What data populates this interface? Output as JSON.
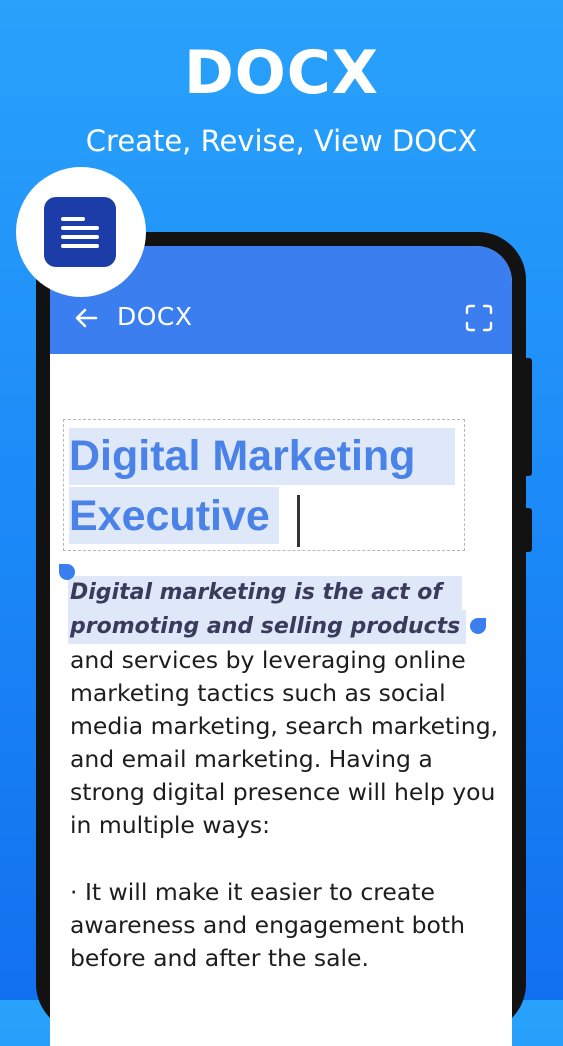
{
  "hero": {
    "title": "DOCX",
    "subtitle": "Create, Revise, View DOCX"
  },
  "appbar": {
    "title": "DOCX",
    "back_icon": "back-arrow-icon",
    "fullscreen_icon": "fullscreen-icon"
  },
  "badge": {
    "icon": "document-icon"
  },
  "document": {
    "heading": "Digital Marketing Executive",
    "intro": "Digital marketing is the act of promoting and selling products",
    "body": "and services by leveraging online marketing tactics such as social media marketing, search marketing, and email marketing. Having a strong digital presence will help you in multiple ways:",
    "bullet": "· It will make it easier to create awareness and engagement both before and after the sale."
  },
  "colors": {
    "background": "#1b88f7",
    "appbar": "#3a7ef0",
    "heading": "#4a82e8",
    "highlight": "#dfe8f9",
    "badge_icon": "#1c3da8"
  }
}
